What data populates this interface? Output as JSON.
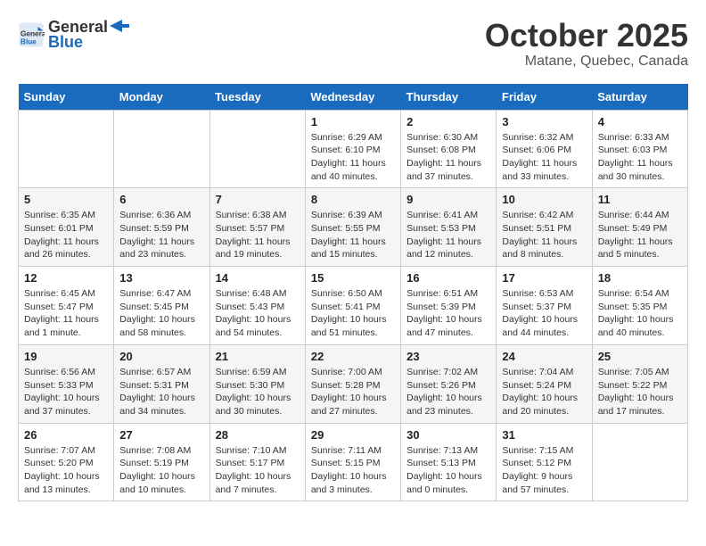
{
  "header": {
    "logo_line1": "General",
    "logo_line2": "Blue",
    "month": "October 2025",
    "location": "Matane, Quebec, Canada"
  },
  "days_of_week": [
    "Sunday",
    "Monday",
    "Tuesday",
    "Wednesday",
    "Thursday",
    "Friday",
    "Saturday"
  ],
  "weeks": [
    [
      {
        "day": "",
        "info": ""
      },
      {
        "day": "",
        "info": ""
      },
      {
        "day": "",
        "info": ""
      },
      {
        "day": "1",
        "info": "Sunrise: 6:29 AM\nSunset: 6:10 PM\nDaylight: 11 hours\nand 40 minutes."
      },
      {
        "day": "2",
        "info": "Sunrise: 6:30 AM\nSunset: 6:08 PM\nDaylight: 11 hours\nand 37 minutes."
      },
      {
        "day": "3",
        "info": "Sunrise: 6:32 AM\nSunset: 6:06 PM\nDaylight: 11 hours\nand 33 minutes."
      },
      {
        "day": "4",
        "info": "Sunrise: 6:33 AM\nSunset: 6:03 PM\nDaylight: 11 hours\nand 30 minutes."
      }
    ],
    [
      {
        "day": "5",
        "info": "Sunrise: 6:35 AM\nSunset: 6:01 PM\nDaylight: 11 hours\nand 26 minutes."
      },
      {
        "day": "6",
        "info": "Sunrise: 6:36 AM\nSunset: 5:59 PM\nDaylight: 11 hours\nand 23 minutes."
      },
      {
        "day": "7",
        "info": "Sunrise: 6:38 AM\nSunset: 5:57 PM\nDaylight: 11 hours\nand 19 minutes."
      },
      {
        "day": "8",
        "info": "Sunrise: 6:39 AM\nSunset: 5:55 PM\nDaylight: 11 hours\nand 15 minutes."
      },
      {
        "day": "9",
        "info": "Sunrise: 6:41 AM\nSunset: 5:53 PM\nDaylight: 11 hours\nand 12 minutes."
      },
      {
        "day": "10",
        "info": "Sunrise: 6:42 AM\nSunset: 5:51 PM\nDaylight: 11 hours\nand 8 minutes."
      },
      {
        "day": "11",
        "info": "Sunrise: 6:44 AM\nSunset: 5:49 PM\nDaylight: 11 hours\nand 5 minutes."
      }
    ],
    [
      {
        "day": "12",
        "info": "Sunrise: 6:45 AM\nSunset: 5:47 PM\nDaylight: 11 hours\nand 1 minute."
      },
      {
        "day": "13",
        "info": "Sunrise: 6:47 AM\nSunset: 5:45 PM\nDaylight: 10 hours\nand 58 minutes."
      },
      {
        "day": "14",
        "info": "Sunrise: 6:48 AM\nSunset: 5:43 PM\nDaylight: 10 hours\nand 54 minutes."
      },
      {
        "day": "15",
        "info": "Sunrise: 6:50 AM\nSunset: 5:41 PM\nDaylight: 10 hours\nand 51 minutes."
      },
      {
        "day": "16",
        "info": "Sunrise: 6:51 AM\nSunset: 5:39 PM\nDaylight: 10 hours\nand 47 minutes."
      },
      {
        "day": "17",
        "info": "Sunrise: 6:53 AM\nSunset: 5:37 PM\nDaylight: 10 hours\nand 44 minutes."
      },
      {
        "day": "18",
        "info": "Sunrise: 6:54 AM\nSunset: 5:35 PM\nDaylight: 10 hours\nand 40 minutes."
      }
    ],
    [
      {
        "day": "19",
        "info": "Sunrise: 6:56 AM\nSunset: 5:33 PM\nDaylight: 10 hours\nand 37 minutes."
      },
      {
        "day": "20",
        "info": "Sunrise: 6:57 AM\nSunset: 5:31 PM\nDaylight: 10 hours\nand 34 minutes."
      },
      {
        "day": "21",
        "info": "Sunrise: 6:59 AM\nSunset: 5:30 PM\nDaylight: 10 hours\nand 30 minutes."
      },
      {
        "day": "22",
        "info": "Sunrise: 7:00 AM\nSunset: 5:28 PM\nDaylight: 10 hours\nand 27 minutes."
      },
      {
        "day": "23",
        "info": "Sunrise: 7:02 AM\nSunset: 5:26 PM\nDaylight: 10 hours\nand 23 minutes."
      },
      {
        "day": "24",
        "info": "Sunrise: 7:04 AM\nSunset: 5:24 PM\nDaylight: 10 hours\nand 20 minutes."
      },
      {
        "day": "25",
        "info": "Sunrise: 7:05 AM\nSunset: 5:22 PM\nDaylight: 10 hours\nand 17 minutes."
      }
    ],
    [
      {
        "day": "26",
        "info": "Sunrise: 7:07 AM\nSunset: 5:20 PM\nDaylight: 10 hours\nand 13 minutes."
      },
      {
        "day": "27",
        "info": "Sunrise: 7:08 AM\nSunset: 5:19 PM\nDaylight: 10 hours\nand 10 minutes."
      },
      {
        "day": "28",
        "info": "Sunrise: 7:10 AM\nSunset: 5:17 PM\nDaylight: 10 hours\nand 7 minutes."
      },
      {
        "day": "29",
        "info": "Sunrise: 7:11 AM\nSunset: 5:15 PM\nDaylight: 10 hours\nand 3 minutes."
      },
      {
        "day": "30",
        "info": "Sunrise: 7:13 AM\nSunset: 5:13 PM\nDaylight: 10 hours\nand 0 minutes."
      },
      {
        "day": "31",
        "info": "Sunrise: 7:15 AM\nSunset: 5:12 PM\nDaylight: 9 hours\nand 57 minutes."
      },
      {
        "day": "",
        "info": ""
      }
    ]
  ]
}
